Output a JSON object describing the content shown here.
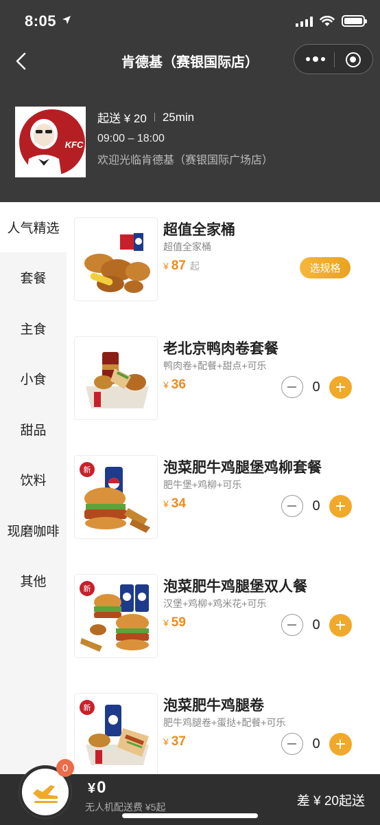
{
  "status_bar": {
    "time": "8:05"
  },
  "nav": {
    "title": "肯德基（赛银国际店）"
  },
  "store": {
    "logo_text": "KFC",
    "min_order": "起送 ¥ 20",
    "delivery_time": "25min",
    "hours": "09:00 – 18:00",
    "welcome": "欢迎光临肯德基（赛银国际广场店）"
  },
  "categories": [
    {
      "label": "人气精选",
      "active": true
    },
    {
      "label": "套餐",
      "active": false
    },
    {
      "label": "主食",
      "active": false
    },
    {
      "label": "小食",
      "active": false
    },
    {
      "label": "甜品",
      "active": false
    },
    {
      "label": "饮料",
      "active": false
    },
    {
      "label": "现磨咖啡",
      "active": false
    },
    {
      "label": "其他",
      "active": false
    }
  ],
  "products": [
    {
      "name": "超值全家桶",
      "desc": "超值全家桶",
      "currency": "¥",
      "price": "87",
      "price_suffix": "起",
      "action": "选规格",
      "is_new": false
    },
    {
      "name": "老北京鸭肉卷套餐",
      "desc": "鸭肉卷+配餐+甜点+可乐",
      "currency": "¥",
      "price": "36",
      "qty": "0",
      "is_new": false
    },
    {
      "name": "泡菜肥牛鸡腿堡鸡柳套餐",
      "desc": "肥牛堡+鸡柳+可乐",
      "currency": "¥",
      "price": "34",
      "qty": "0",
      "is_new": true,
      "new_label": "新"
    },
    {
      "name": "泡菜肥牛鸡腿堡双人餐",
      "desc": "汉堡+鸡柳+鸡米花+可乐",
      "currency": "¥",
      "price": "59",
      "qty": "0",
      "is_new": true,
      "new_label": "新"
    },
    {
      "name": "泡菜肥牛鸡腿卷",
      "desc": "肥牛鸡腿卷+蛋挞+配餐+可乐",
      "currency": "¥",
      "price": "37",
      "qty": "0",
      "is_new": true,
      "new_label": "新"
    }
  ],
  "cart": {
    "badge": "0",
    "currency": "¥",
    "total": "0",
    "fee_note": "无人机配送费 ¥5起",
    "min_note": "差 ¥ 20起送"
  },
  "colors": {
    "accent": "#f0a92a",
    "price": "#f08a1a",
    "header_bg": "#3a3a3a",
    "bottom_bg": "#2f2f2f",
    "badge": "#ec6b4a"
  }
}
